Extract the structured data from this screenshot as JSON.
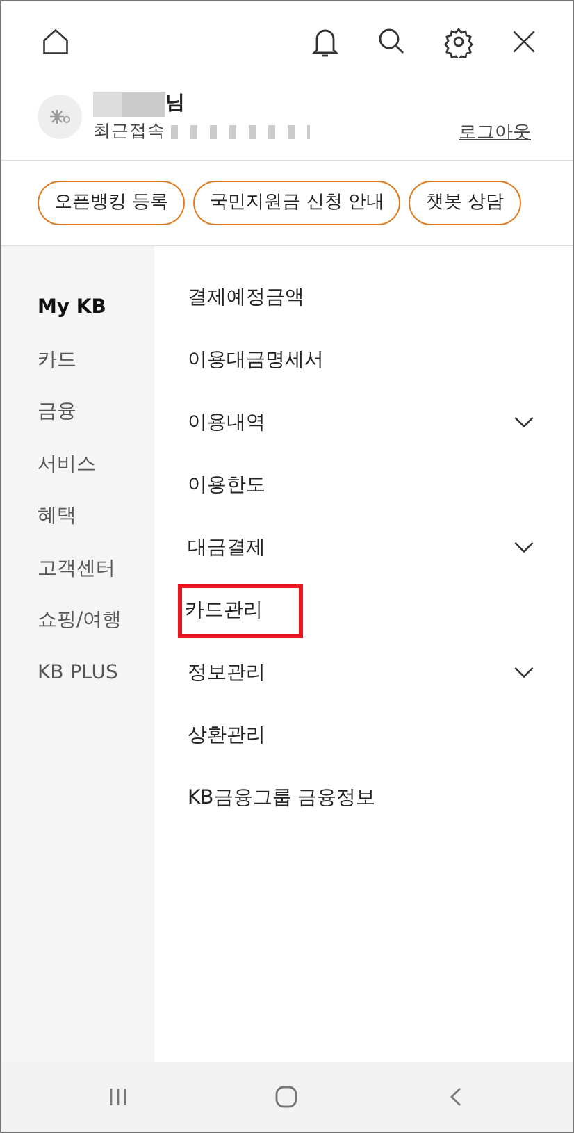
{
  "user": {
    "name_suffix": "님",
    "last_login_label": "최근접속",
    "logout": "로그아웃"
  },
  "chips": [
    "오픈뱅킹 등록",
    "국민지원금 신청 안내",
    "챗봇 상담"
  ],
  "sidebar": {
    "items": [
      {
        "label": "My KB",
        "selected": true
      },
      {
        "label": "카드",
        "selected": false
      },
      {
        "label": "금융",
        "selected": false
      },
      {
        "label": "서비스",
        "selected": false
      },
      {
        "label": "혜택",
        "selected": false
      },
      {
        "label": "고객센터",
        "selected": false
      },
      {
        "label": "쇼핑/여행",
        "selected": false
      },
      {
        "label": "KB PLUS",
        "selected": false
      }
    ]
  },
  "menu": {
    "items": [
      {
        "label": "결제예정금액",
        "expandable": false,
        "highlighted": false
      },
      {
        "label": "이용대금명세서",
        "expandable": false,
        "highlighted": false
      },
      {
        "label": "이용내역",
        "expandable": true,
        "highlighted": false
      },
      {
        "label": "이용한도",
        "expandable": false,
        "highlighted": false
      },
      {
        "label": "대금결제",
        "expandable": true,
        "highlighted": false
      },
      {
        "label": "카드관리",
        "expandable": false,
        "highlighted": true
      },
      {
        "label": "정보관리",
        "expandable": true,
        "highlighted": false
      },
      {
        "label": "상환관리",
        "expandable": false,
        "highlighted": false
      },
      {
        "label": "KB금융그룹 금융정보",
        "expandable": false,
        "highlighted": false
      }
    ]
  }
}
